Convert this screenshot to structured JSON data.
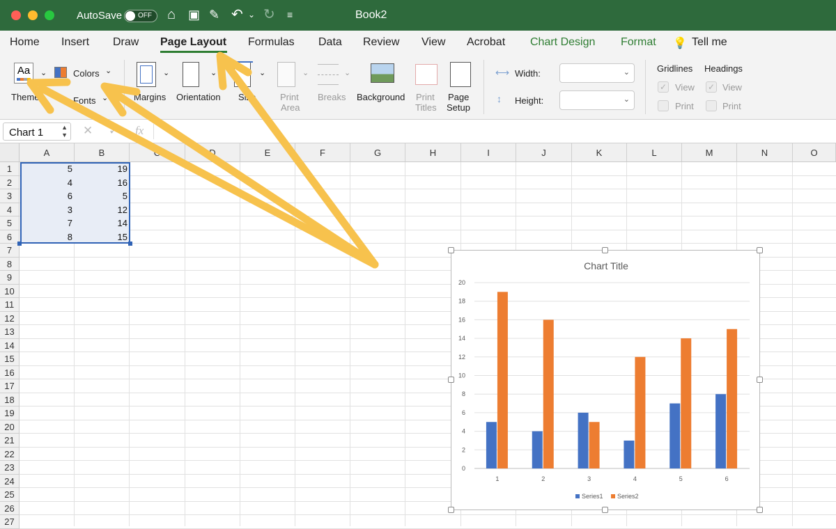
{
  "titlebar": {
    "autosave_label": "AutoSave",
    "autosave_state": "OFF",
    "doc_title": "Book2"
  },
  "menu": {
    "tabs": [
      "Home",
      "Insert",
      "Draw",
      "Page Layout",
      "Formulas",
      "Data",
      "Review",
      "View",
      "Acrobat",
      "Chart Design",
      "Format"
    ],
    "tell_me": "Tell me",
    "active_tab": "Page Layout"
  },
  "ribbon": {
    "themes": "Themes",
    "colors": "Colors",
    "fonts": "Fonts",
    "margins": "Margins",
    "orientation": "Orientation",
    "size": "Size",
    "print_area_1": "Print",
    "print_area_2": "Area",
    "breaks": "Breaks",
    "background": "Background",
    "print_titles_1": "Print",
    "print_titles_2": "Titles",
    "page_setup_1": "Page",
    "page_setup_2": "Setup",
    "width_label": "Width:",
    "height_label": "Height:",
    "gridlines": "Gridlines",
    "headings": "Headings",
    "view": "View",
    "print": "Print"
  },
  "formula_bar": {
    "name_box": "Chart 1",
    "fx": "fx"
  },
  "sheet": {
    "columns": [
      "A",
      "B",
      "C",
      "D",
      "E",
      "F",
      "G",
      "H",
      "I",
      "J",
      "K",
      "L",
      "M",
      "N",
      "O"
    ],
    "rows": [
      "1",
      "2",
      "3",
      "4",
      "5",
      "6",
      "7",
      "8",
      "9",
      "10",
      "11",
      "12",
      "13",
      "14",
      "15",
      "16",
      "17",
      "18",
      "19",
      "20",
      "21",
      "22",
      "23",
      "24",
      "25",
      "26",
      "27"
    ],
    "data": [
      [
        "5",
        "19"
      ],
      [
        "4",
        "16"
      ],
      [
        "6",
        "5"
      ],
      [
        "3",
        "12"
      ],
      [
        "7",
        "14"
      ],
      [
        "8",
        "15"
      ]
    ]
  },
  "chart_data": {
    "type": "bar",
    "title": "Chart Title",
    "categories": [
      "1",
      "2",
      "3",
      "4",
      "5",
      "6"
    ],
    "series": [
      {
        "name": "Series1",
        "values": [
          5,
          4,
          6,
          3,
          7,
          8
        ],
        "color": "#4472c4"
      },
      {
        "name": "Series2",
        "values": [
          19,
          16,
          5,
          12,
          14,
          15
        ],
        "color": "#ed7d31"
      }
    ],
    "ylim": [
      0,
      20
    ],
    "yticks": [
      "0",
      "2",
      "4",
      "6",
      "8",
      "10",
      "12",
      "14",
      "16",
      "18",
      "20"
    ],
    "grid": true,
    "legend": "bottom"
  },
  "annotations": {
    "arrow_color": "#f7c24d"
  }
}
